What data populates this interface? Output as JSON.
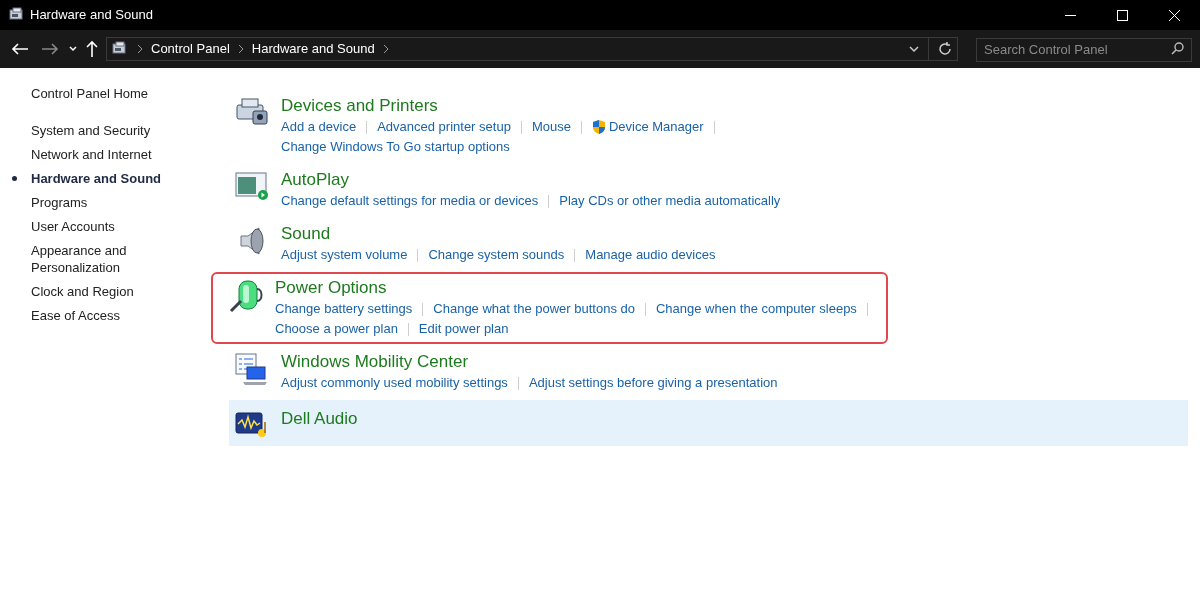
{
  "window": {
    "title": "Hardware and Sound"
  },
  "breadcrumb": [
    "Control Panel",
    "Hardware and Sound"
  ],
  "search": {
    "placeholder": "Search Control Panel"
  },
  "sidebar": {
    "home": "Control Panel Home",
    "items": [
      {
        "label": "System and Security",
        "selected": false
      },
      {
        "label": "Network and Internet",
        "selected": false
      },
      {
        "label": "Hardware and Sound",
        "selected": true
      },
      {
        "label": "Programs",
        "selected": false
      },
      {
        "label": "User Accounts",
        "selected": false
      },
      {
        "label": "Appearance and Personalization",
        "selected": false
      },
      {
        "label": "Clock and Region",
        "selected": false
      },
      {
        "label": "Ease of Access",
        "selected": false
      }
    ]
  },
  "sections": [
    {
      "kind": "printer",
      "title": "Devices and Printers",
      "highlighted": false,
      "selected": false,
      "lines": [
        {
          "links": [
            {
              "label": "Add a device",
              "shield": false
            },
            {
              "label": "Advanced printer setup",
              "shield": false
            },
            {
              "label": "Mouse",
              "shield": false
            },
            {
              "label": "Device Manager",
              "shield": true
            }
          ],
          "trailing_separator": true
        },
        {
          "links": [
            {
              "label": "Change Windows To Go startup options",
              "shield": false
            }
          ],
          "trailing_separator": false
        }
      ]
    },
    {
      "kind": "autoplay",
      "title": "AutoPlay",
      "highlighted": false,
      "selected": false,
      "lines": [
        {
          "links": [
            {
              "label": "Change default settings for media or devices",
              "shield": false
            },
            {
              "label": "Play CDs or other media automatically",
              "shield": false
            }
          ],
          "trailing_separator": false
        }
      ]
    },
    {
      "kind": "sound",
      "title": "Sound",
      "highlighted": false,
      "selected": false,
      "lines": [
        {
          "links": [
            {
              "label": "Adjust system volume",
              "shield": false
            },
            {
              "label": "Change system sounds",
              "shield": false
            },
            {
              "label": "Manage audio devices",
              "shield": false
            }
          ],
          "trailing_separator": false
        }
      ]
    },
    {
      "kind": "power",
      "title": "Power Options",
      "highlighted": true,
      "selected": false,
      "lines": [
        {
          "links": [
            {
              "label": "Change battery settings",
              "shield": false
            },
            {
              "label": "Change what the power buttons do",
              "shield": false
            },
            {
              "label": "Change when the computer sleeps",
              "shield": false
            }
          ],
          "trailing_separator": true
        },
        {
          "links": [
            {
              "label": "Choose a power plan",
              "shield": false
            },
            {
              "label": "Edit power plan",
              "shield": false
            }
          ],
          "trailing_separator": false
        }
      ]
    },
    {
      "kind": "mobility",
      "title": "Windows Mobility Center",
      "highlighted": false,
      "selected": false,
      "lines": [
        {
          "links": [
            {
              "label": "Adjust commonly used mobility settings",
              "shield": false
            },
            {
              "label": "Adjust settings before giving a presentation",
              "shield": false
            }
          ],
          "trailing_separator": false
        }
      ]
    },
    {
      "kind": "audio",
      "title": "Dell Audio",
      "highlighted": false,
      "selected": true
    }
  ]
}
